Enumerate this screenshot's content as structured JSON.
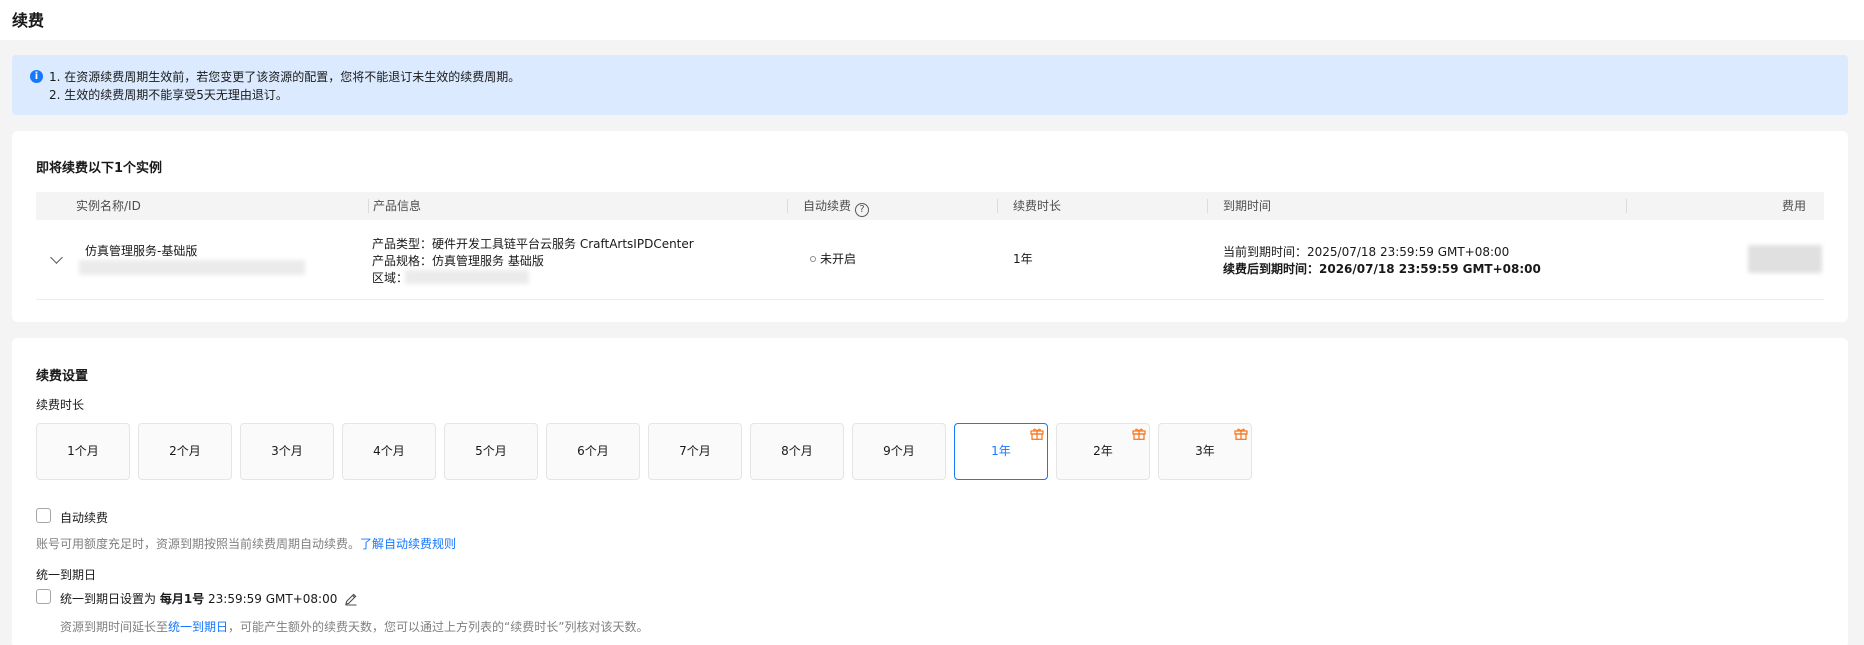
{
  "page": {
    "title": "续费"
  },
  "notice": {
    "line1": "1. 在资源续费周期生效前，若您变更了该资源的配置，您将不能退订未生效的续费周期。",
    "line2": "2. 生效的续费周期不能享受5天无理由退订。"
  },
  "instances": {
    "title": "即将续费以下1个实例",
    "columns": {
      "name": "实例名称/ID",
      "product": "产品信息",
      "auto_renew": "自动续费",
      "duration": "续费时长",
      "expire": "到期时间",
      "fee": "费用"
    },
    "row": {
      "name": "仿真管理服务-基础版",
      "product_type": "产品类型：硬件开发工具链平台云服务 CraftArtsIPDCenter",
      "product_spec": "产品规格：仿真管理服务 基础版",
      "region_label": "区域：",
      "auto_renew_status": "未开启",
      "duration": "1年",
      "current_expire": "当前到期时间：2025/07/18 23:59:59 GMT+08:00",
      "after_expire": "续费后到期时间：2026/07/18 23:59:59 GMT+08:00"
    }
  },
  "settings": {
    "title": "续费设置",
    "duration_label": "续费时长",
    "durations": [
      {
        "label": "1个月",
        "gift": false
      },
      {
        "label": "2个月",
        "gift": false
      },
      {
        "label": "3个月",
        "gift": false
      },
      {
        "label": "4个月",
        "gift": false
      },
      {
        "label": "5个月",
        "gift": false
      },
      {
        "label": "6个月",
        "gift": false
      },
      {
        "label": "7个月",
        "gift": false
      },
      {
        "label": "8个月",
        "gift": false
      },
      {
        "label": "9个月",
        "gift": false
      },
      {
        "label": "1年",
        "gift": true,
        "selected": true
      },
      {
        "label": "2年",
        "gift": true
      },
      {
        "label": "3年",
        "gift": true
      }
    ],
    "auto_renew_label": "自动续费",
    "auto_renew_hint": "账号可用额度充足时，资源到期按照当前续费周期自动续费。",
    "auto_renew_link": "了解自动续费规则",
    "unify_section": "统一到期日",
    "unify_prefix": "统一到期日设置为",
    "unify_day": "每月1号",
    "unify_time": "23:59:59 GMT+08:00",
    "unify_hint_prefix": "资源到期时间延长至",
    "unify_hint_link": "统一到期日",
    "unify_hint_suffix": "，可能产生额外的续费天数，您可以通过上方列表的“续费时长”列核对该天数。"
  },
  "colors": {
    "accent": "#1677ff",
    "notice_bg": "#dbeafe",
    "gift": "#f97316"
  }
}
